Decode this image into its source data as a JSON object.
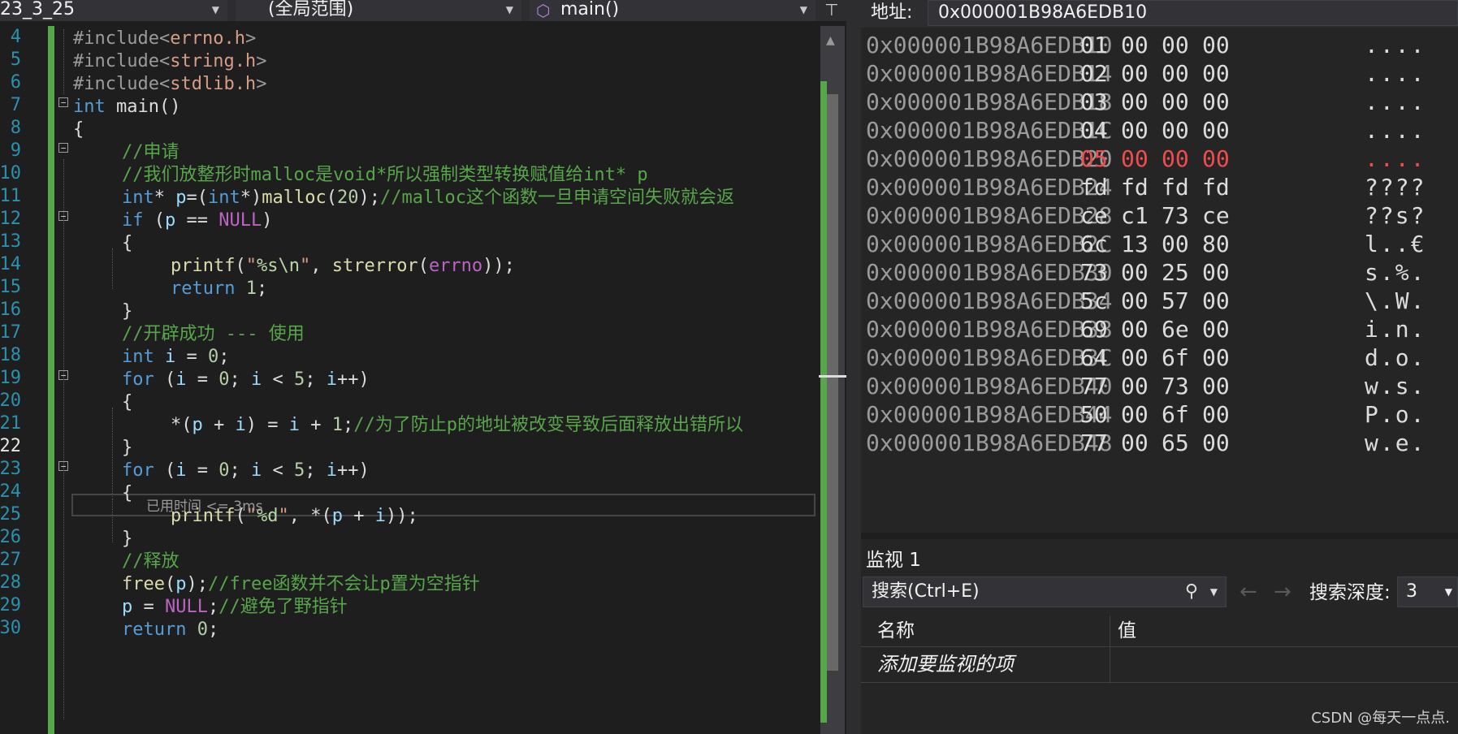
{
  "nav": {
    "project": "23_3_25",
    "scope": "(全局范围)",
    "function": "main()"
  },
  "line_numbers": [
    "4",
    "5",
    "6",
    "7",
    "8",
    "9",
    "10",
    "11",
    "12",
    "13",
    "14",
    "15",
    "16",
    "17",
    "18",
    "19",
    "20",
    "21",
    "22",
    "23",
    "24",
    "25",
    "26",
    "27",
    "28",
    "29",
    "30"
  ],
  "current_line": "22",
  "code": {
    "l4_a": "#include<",
    "l4_b": "errno.h",
    "l4_c": ">",
    "l5_a": "#include<",
    "l5_b": "string.h",
    "l5_c": ">",
    "l6_a": "#include<",
    "l6_b": "stdlib.h",
    "l6_c": ">",
    "l7_a": "int",
    "l7_b": " main()",
    "l8": "{",
    "l9": "//申请",
    "l10": "//我们放整形时malloc是void*所以强制类型转换赋值给int* p",
    "l11_a": "int",
    "l11_b": "* ",
    "l11_c": "p",
    "l11_d": "=(",
    "l11_e": "int",
    "l11_f": "*)",
    "l11_g": "malloc",
    "l11_h": "(",
    "l11_i": "20",
    "l11_j": ");",
    "l11_k": "//malloc这个函数一旦申请空间失败就会返",
    "l12_a": "if",
    "l12_b": " (",
    "l12_c": "p",
    "l12_d": " == ",
    "l12_e": "NULL",
    "l12_f": ")",
    "l13": "{",
    "l14_a": "printf",
    "l14_b": "(",
    "l14_c": "\"",
    "l14_d": "%s\\n",
    "l14_e": "\"",
    "l14_f": ", ",
    "l14_g": "strerror",
    "l14_h": "(",
    "l14_i": "errno",
    "l14_j": "));",
    "l15_a": "return",
    "l15_b": " ",
    "l15_c": "1",
    "l15_d": ";",
    "l16": "}",
    "l17": "//开辟成功 --- 使用",
    "l18_a": "int",
    "l18_b": " ",
    "l18_c": "i",
    "l18_d": " = ",
    "l18_e": "0",
    "l18_f": ";",
    "l19_a": "for",
    "l19_b": " (",
    "l19_c": "i",
    "l19_d": " = ",
    "l19_e": "0",
    "l19_f": "; ",
    "l19_g": "i",
    "l19_h": " < ",
    "l19_i": "5",
    "l19_j": "; ",
    "l19_k": "i",
    "l19_l": "++)",
    "l20": "{",
    "l21_a": "*(",
    "l21_b": "p",
    "l21_c": " + ",
    "l21_d": "i",
    "l21_e": ") = ",
    "l21_f": "i",
    "l21_g": " + ",
    "l21_h": "1",
    "l21_i": ";",
    "l21_j": "//为了防止p的地址被改变导致后面释放出错所以",
    "l22": "}",
    "l23_a": "for",
    "l23_b": " (",
    "l23_c": "i",
    "l23_d": " = ",
    "l23_e": "0",
    "l23_f": "; ",
    "l23_g": "i",
    "l23_h": " < ",
    "l23_i": "5",
    "l23_j": "; ",
    "l23_k": "i",
    "l23_l": "++)",
    "l24": "{",
    "l25_a": "printf",
    "l25_b": "(",
    "l25_c": "\"",
    "l25_d": "%d",
    "l25_e": "\"",
    "l25_f": ", *(",
    "l25_g": "p",
    "l25_h": " + ",
    "l25_i": "i",
    "l25_j": "));",
    "l26": "}",
    "l27": "//释放",
    "l28_a": "free",
    "l28_b": "(",
    "l28_c": "p",
    "l28_d": ");",
    "l28_e": "//free函数并不会让p置为空指针",
    "l29_a": "p",
    "l29_b": " = ",
    "l29_c": "NULL",
    "l29_d": ";",
    "l29_e": "//避免了野指针",
    "l30_a": "return",
    "l30_b": " ",
    "l30_c": "0",
    "l30_d": ";"
  },
  "perf_tip": "已用时间 <= 3ms",
  "memory": {
    "address_label": "地址:",
    "address_value": "0x000001B98A6EDB10",
    "rows": [
      {
        "addr": "0x000001B98A6EDB10",
        "bytes": [
          "01",
          "00",
          "00",
          "00"
        ],
        "text": "...."
      },
      {
        "addr": "0x000001B98A6EDB14",
        "bytes": [
          "02",
          "00",
          "00",
          "00"
        ],
        "text": "...."
      },
      {
        "addr": "0x000001B98A6EDB18",
        "bytes": [
          "03",
          "00",
          "00",
          "00"
        ],
        "text": "...."
      },
      {
        "addr": "0x000001B98A6EDB1C",
        "bytes": [
          "04",
          "00",
          "00",
          "00"
        ],
        "text": "...."
      },
      {
        "addr": "0x000001B98A6EDB20",
        "bytes": [
          "05",
          "00",
          "00",
          "00"
        ],
        "text": "....",
        "changed": true
      },
      {
        "addr": "0x000001B98A6EDB24",
        "bytes": [
          "fd",
          "fd",
          "fd",
          "fd"
        ],
        "text": "????"
      },
      {
        "addr": "0x000001B98A6EDB28",
        "bytes": [
          "ce",
          "c1",
          "73",
          "ce"
        ],
        "text": "??s?"
      },
      {
        "addr": "0x000001B98A6EDB2C",
        "bytes": [
          "6c",
          "13",
          "00",
          "80"
        ],
        "text": "l..€"
      },
      {
        "addr": "0x000001B98A6EDB30",
        "bytes": [
          "73",
          "00",
          "25",
          "00"
        ],
        "text": "s.%."
      },
      {
        "addr": "0x000001B98A6EDB34",
        "bytes": [
          "5c",
          "00",
          "57",
          "00"
        ],
        "text": "\\.W."
      },
      {
        "addr": "0x000001B98A6EDB38",
        "bytes": [
          "69",
          "00",
          "6e",
          "00"
        ],
        "text": "i.n."
      },
      {
        "addr": "0x000001B98A6EDB3C",
        "bytes": [
          "64",
          "00",
          "6f",
          "00"
        ],
        "text": "d.o."
      },
      {
        "addr": "0x000001B98A6EDB40",
        "bytes": [
          "77",
          "00",
          "73",
          "00"
        ],
        "text": "w.s."
      },
      {
        "addr": "0x000001B98A6EDB44",
        "bytes": [
          "50",
          "00",
          "6f",
          "00"
        ],
        "text": "P.o."
      },
      {
        "addr": "0x000001B98A6EDB48",
        "bytes": [
          "77",
          "00",
          "65",
          "00"
        ],
        "text": "w.e."
      }
    ]
  },
  "watch": {
    "title": "监视 1",
    "search_placeholder": "搜索(Ctrl+E)",
    "depth_label": "搜索深度:",
    "depth_value": "3",
    "col_name": "名称",
    "col_value": "值",
    "add_item": "添加要监视的项"
  },
  "watermark": "CSDN @每天一点点.",
  "colors": {
    "accent_green": "#57a64a",
    "changed_red": "#f14c4c",
    "keyword_blue": "#569cd6"
  }
}
